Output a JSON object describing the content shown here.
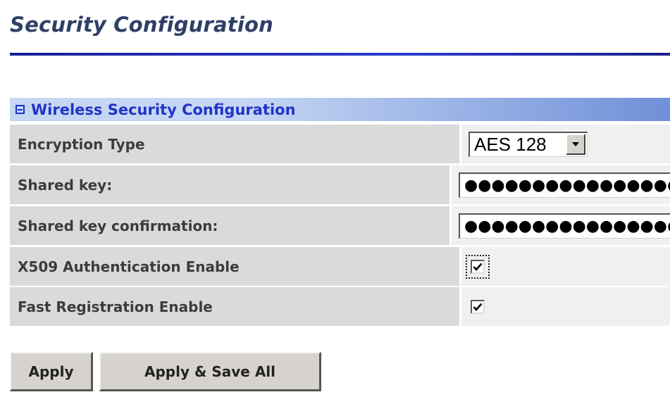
{
  "page": {
    "title": "Security Configuration"
  },
  "section": {
    "title": "Wireless Security Configuration",
    "icon": "collapse-minus-icon"
  },
  "fields": {
    "encryption_type": {
      "label": "Encryption Type",
      "selected": "AES 128"
    },
    "shared_key": {
      "label": "Shared key:",
      "masked_value": "●●●●●●●●●●●●●●●●"
    },
    "shared_key_confirmation": {
      "label": "Shared key confirmation:",
      "masked_value": "●●●●●●●●●●●●●●●●"
    },
    "x509_auth": {
      "label": "X509 Authentication Enable",
      "checked": true
    },
    "fast_registration": {
      "label": "Fast Registration Enable",
      "checked": true
    }
  },
  "buttons": {
    "apply": "Apply",
    "apply_save_all": "Apply & Save All"
  },
  "colors": {
    "title_text": "#2f3f66",
    "title_rule": "#1a2bb0",
    "section_text": "#2233c9",
    "label_cell_bg": "#dadada",
    "value_cell_bg": "#f0f0f0",
    "button_bg": "#d6d3ce"
  }
}
